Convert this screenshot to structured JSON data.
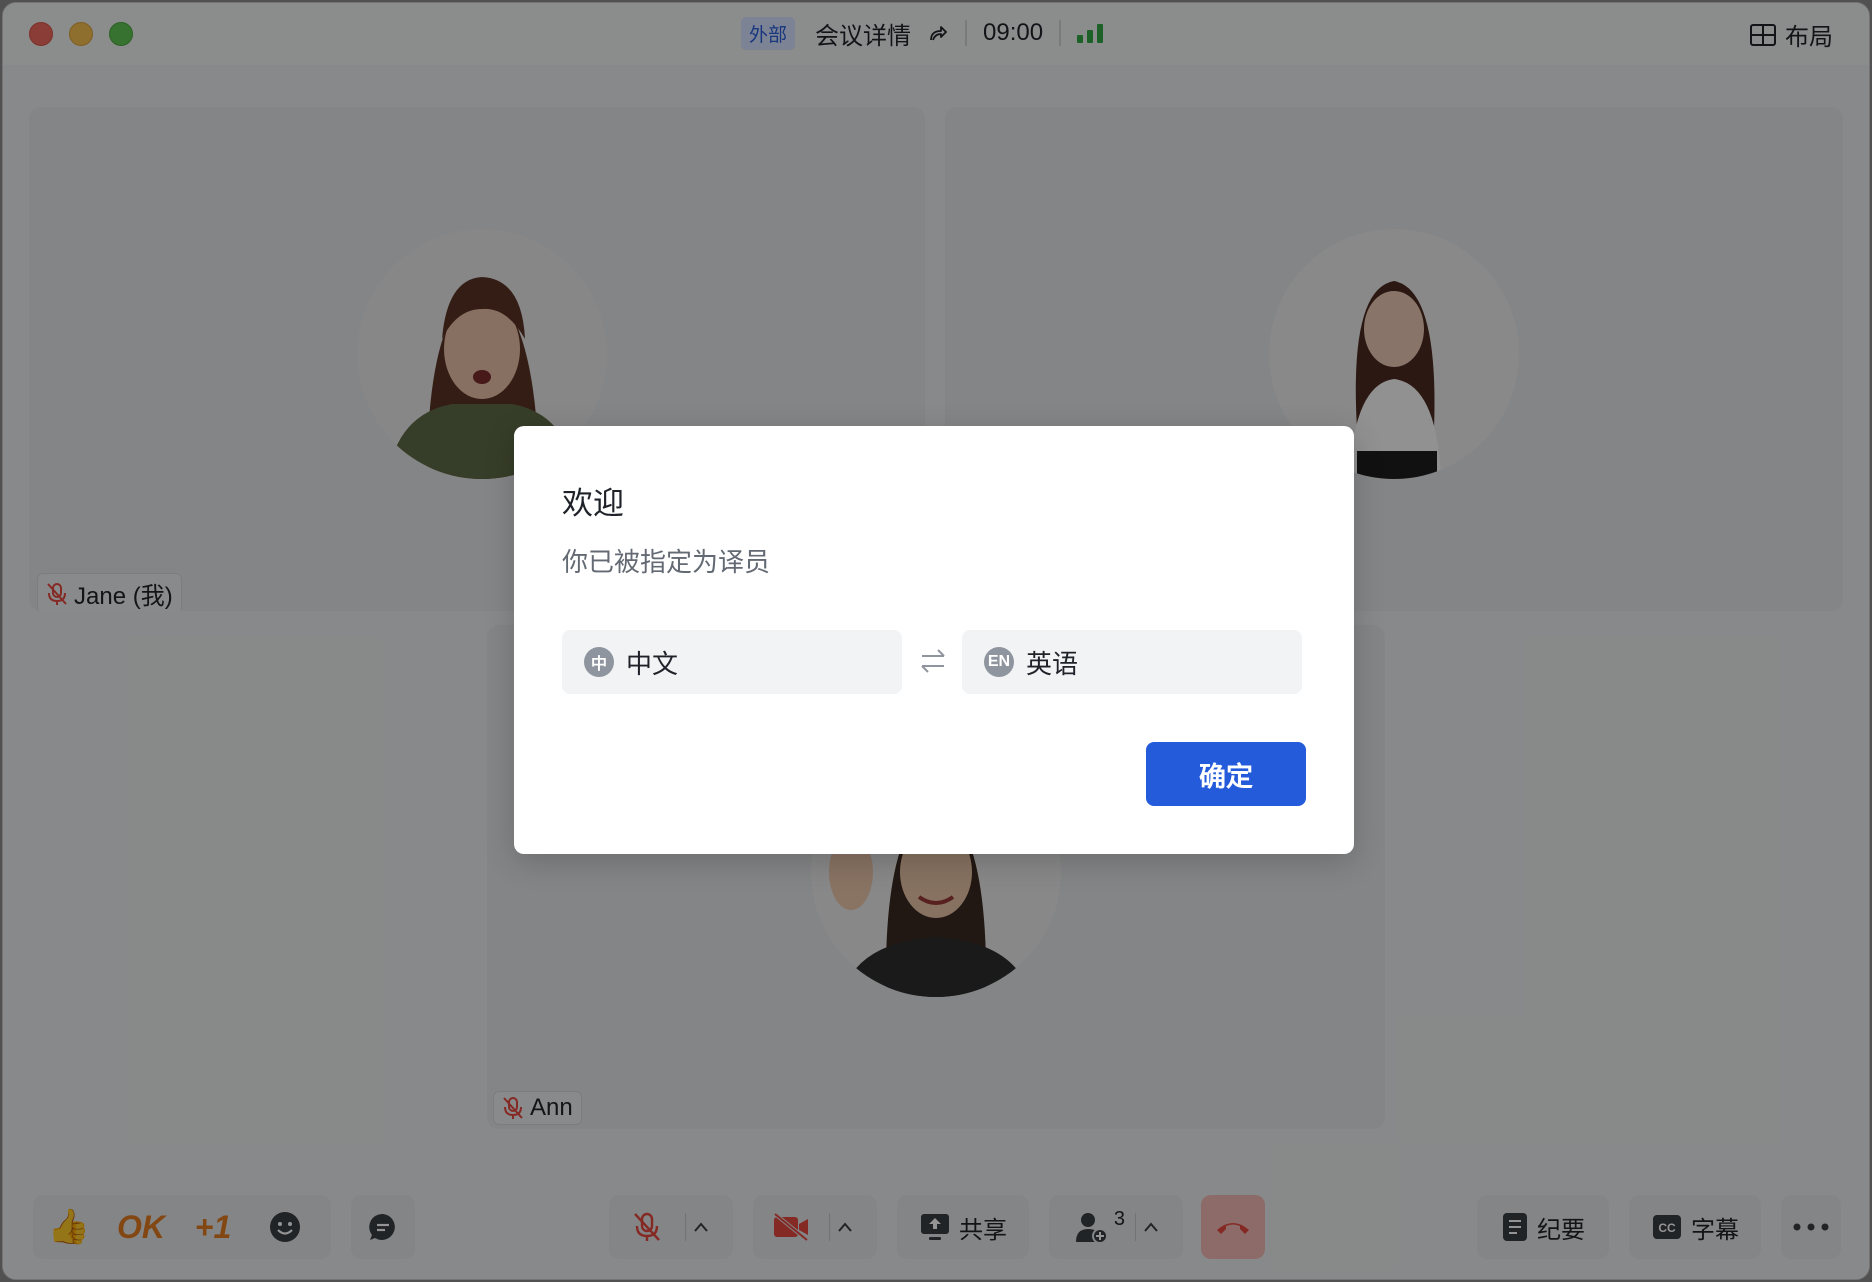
{
  "titlebar": {
    "external_badge": "外部",
    "meeting_details": "会议详情",
    "time": "09:00",
    "layout_label": "布局"
  },
  "participants": [
    {
      "name": "Jane (我)",
      "muted": true
    },
    {
      "name": "",
      "muted": false
    },
    {
      "name": "Ann",
      "muted": true
    }
  ],
  "toolbar": {
    "reactions": [
      "👍",
      "OK",
      "+1"
    ],
    "share_label": "共享",
    "participants_count": "3",
    "minutes_label": "纪要",
    "captions_label": "字幕"
  },
  "dialog": {
    "title": "欢迎",
    "message": "你已被指定为译员",
    "source_lang": {
      "icon": "中",
      "label": "中文"
    },
    "target_lang": {
      "icon": "EN",
      "label": "英语"
    },
    "confirm_label": "确定"
  },
  "colors": {
    "primary": "#245bdb",
    "signal_green": "#32a645",
    "hangup_red": "#e5473e",
    "mic_muted_red": "#e5473e"
  }
}
